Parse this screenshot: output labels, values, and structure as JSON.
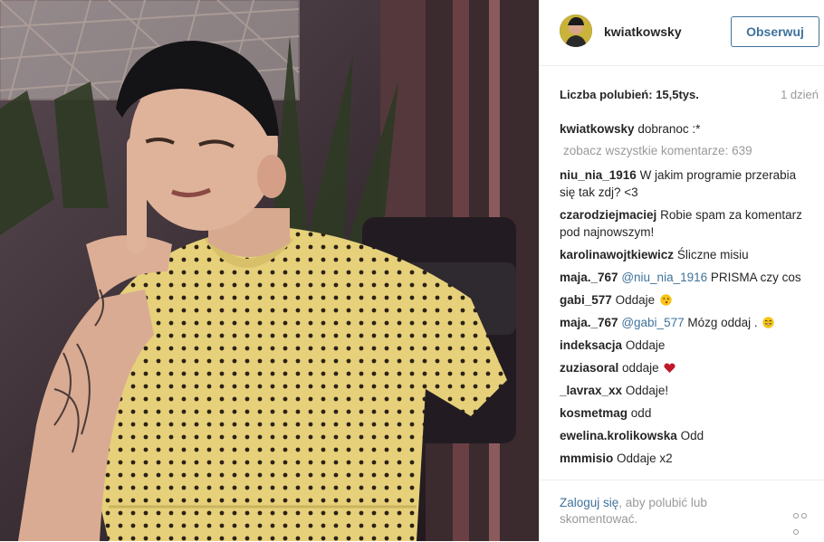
{
  "post": {
    "username": "kwiatkowsky",
    "follow_label": "Obserwuj",
    "likes_label": "Liczba polubień: 15,5tys.",
    "time_ago": "1 dzień",
    "view_all_comments": "zobacz wszystkie komentarze: 639"
  },
  "caption": {
    "user": "kwiatkowsky",
    "text": "dobranoc :*"
  },
  "comments": [
    {
      "user": "niu_nia_1916",
      "text": "W jakim programie przerabia się tak zdj? <3"
    },
    {
      "user": "czarodziejmaciej",
      "text": "Robie spam za komentarz pod najnowszym!"
    },
    {
      "user": "karolinawojtkiewicz",
      "text": "Śliczne misiu"
    },
    {
      "user": "maja._767",
      "mention": "@niu_nia_1916",
      "text": "PRISMA czy cos"
    },
    {
      "user": "gabi_577",
      "text": "Oddaje",
      "emoji": "kiss-emoji"
    },
    {
      "user": "maja._767",
      "mention": "@gabi_577",
      "text": "Mózg oddaj .",
      "emoji": "grin-emoji"
    },
    {
      "user": "indeksacja",
      "text": "Oddaje"
    },
    {
      "user": "zuziasoral",
      "text": "oddaje",
      "emoji": "heart-emoji"
    },
    {
      "user": "_lavrax_xx",
      "text": "Oddaje!"
    },
    {
      "user": "kosmetmag",
      "text": "odd"
    },
    {
      "user": "ewelina.krolikowska",
      "text": "Odd"
    },
    {
      "user": "mmmisio",
      "text": "Oddaje x2"
    }
  ],
  "footer": {
    "login_link": "Zaloguj się",
    "login_rest": ", aby polubić lub skomentować."
  },
  "colors": {
    "link": "#3f729b",
    "muted": "#999999",
    "text": "#262626",
    "heart": "#c0182a",
    "emoji_yellow": "#f5c518"
  }
}
